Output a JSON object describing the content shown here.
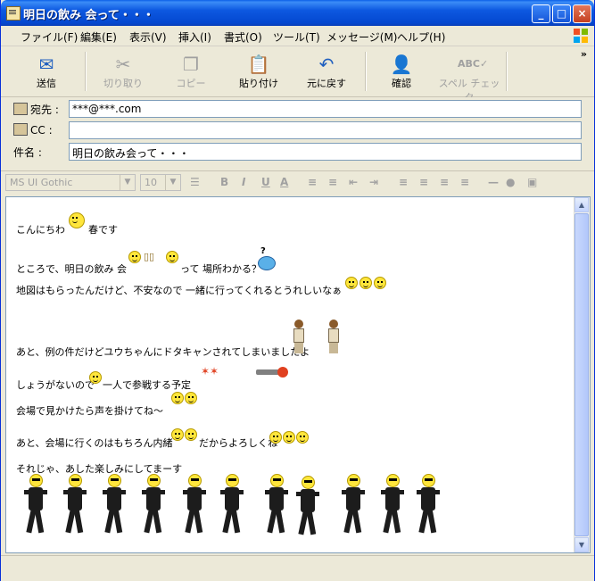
{
  "window": {
    "title": "明日の飲み 会って・・・"
  },
  "menu": [
    "ファイル(F)",
    "編集(E)",
    "表示(V)",
    "挿入(I)",
    "書式(O)",
    "ツール(T)",
    "メッセージ(M)",
    "ヘルプ(H)"
  ],
  "toolbar": {
    "send": "送信",
    "cut": "切り取り",
    "copy": "コピー",
    "paste": "貼り付け",
    "undo": "元に戻す",
    "check": "確認",
    "spell": "スペル チェック"
  },
  "fields": {
    "to_label": "宛先 :",
    "to_value": "***@***.com",
    "cc_label": "CC :",
    "cc_value": "",
    "subject_label": "件名 :",
    "subject_value": "明日の飲み会って・・・"
  },
  "format": {
    "font": "MS UI Gothic",
    "size": "10"
  },
  "message": {
    "l1a": "こんにちわ",
    "l1b": "春です",
    "l2a": "ところで、明日の飲み 会",
    "l2b": "って 場所わかる？",
    "l3": "地図はもらったんだけど、不安なので 一緒に行ってくれるとうれしいなぁ",
    "l4": "あと、例の件だけどユウちゃんにドタキャンされてしまいましたよ",
    "l5a": "しょうがないので",
    "l5b": "一人で参戦する予定",
    "l6": "会場で見かけたら声を掛けてね～",
    "l7a": "あと、会場に行くのはもちろん内緒",
    "l7b": "だからよろしくね",
    "l8": "それじゃ、あした楽しみにしてまーす"
  }
}
